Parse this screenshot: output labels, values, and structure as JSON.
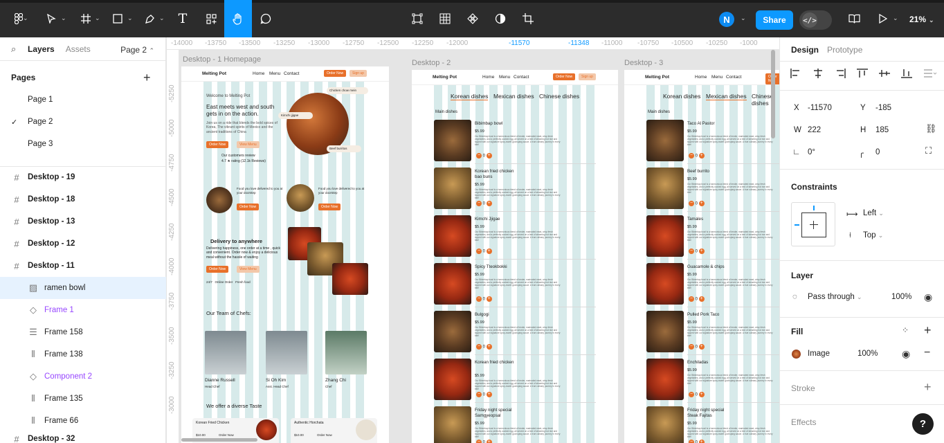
{
  "toolbar": {
    "zoom": "21%",
    "share": "Share",
    "avatar": "N",
    "tools": [
      "main-menu",
      "move-tool",
      "frame-tool",
      "shape-tool",
      "pen-tool",
      "text-tool",
      "resources",
      "hand-tool",
      "comment-tool"
    ],
    "center_tools": [
      "edit-object",
      "auto-layout-grid",
      "component",
      "mask",
      "crop"
    ]
  },
  "left": {
    "layers_tab": "Layers",
    "assets_tab": "Assets",
    "page_selector": "Page 2",
    "pages_heading": "Pages",
    "pages": [
      "Page 1",
      "Page 2",
      "Page 3"
    ],
    "layers": [
      {
        "name": "Desktop - 19",
        "icon": "frame-icon"
      },
      {
        "name": "Desktop - 18",
        "icon": "frame-icon"
      },
      {
        "name": "Desktop - 13",
        "icon": "frame-icon"
      },
      {
        "name": "Desktop - 12",
        "icon": "frame-icon"
      },
      {
        "name": "Desktop - 11",
        "icon": "frame-icon"
      }
    ],
    "children": [
      {
        "name": "ramen bowl",
        "icon": "image-icon"
      },
      {
        "name": "Frame 1",
        "icon": "component-instance-icon"
      },
      {
        "name": "Frame 158",
        "icon": "vertical-layout-icon"
      },
      {
        "name": "Frame 138",
        "icon": "horizontal-layout-icon"
      },
      {
        "name": "Component 2",
        "icon": "component-instance-icon"
      },
      {
        "name": "Frame 135",
        "icon": "horizontal-layout-icon"
      },
      {
        "name": "Frame 66",
        "icon": "horizontal-layout-icon"
      }
    ],
    "partial": "Desktop - 32"
  },
  "ruler": {
    "h": [
      "-14000",
      "-13750",
      "-13500",
      "-13250",
      "-13000",
      "-12750",
      "-12500",
      "-12250",
      "-12000",
      "-11570",
      "-11348",
      "-11000",
      "-10750",
      "-10500",
      "-10250",
      "-1000"
    ],
    "v": [
      "-5250",
      "-5000",
      "-4750",
      "-4500",
      "-4250",
      "-4000",
      "-3750",
      "-3500",
      "-3250",
      "-3000"
    ]
  },
  "canvas": {
    "frame1_label": "Desktop - 1 Homepage",
    "frame2_label": "Desktop - 2",
    "frame3_label": "Desktop - 3",
    "nav": {
      "brand": "Melting Pot",
      "links": [
        "Home",
        "Menu",
        "Contact"
      ],
      "order": "Order Now",
      "signup": "Sign up"
    },
    "home": {
      "welcome": "Welcome to Melting Pot",
      "headline": "East meets west and south gets in on the action.",
      "sub": "Join us on a ride that blends the bold spices of Korea, The vibrant spirits of Mexico and the ancient traditions of China",
      "order": "Order Now",
      "view": "View Menu",
      "reviews": "Our customers review",
      "rating": "4.7",
      "rating_note": "rating (12.1k Reviews)",
      "delivery": "Delivery to anywhere",
      "delivery_sub": "Delivering happiness, one order at a time , quick and convenient. Order now & enjoy a delicious meal without the hassle of waiting",
      "chefs_title": "Our Team of Chefs:",
      "chefs": [
        {
          "name": "Dianne Russell",
          "role": "Head Chef"
        },
        {
          "name": "Si Oh Kim",
          "role": "Asst. Head Chef"
        },
        {
          "name": "Zhang Chi",
          "role": "Chef"
        }
      ],
      "taste": "We offer a diverse Taste",
      "card1": "Korean Fried Chicken",
      "card2": "Authentic Horchata",
      "price1": "$10.00",
      "price2": "$10.00",
      "order_small": "Order Now",
      "bubbles": [
        "Chicken chow mein",
        "Kimchi jjigae",
        "Beef burritos"
      ],
      "love": "Food you love delivered to you at your doorstep",
      "badges": [
        "24/7",
        "Online Order",
        "Fresh food"
      ]
    },
    "menu2": {
      "tabs": [
        "Korean dishes",
        "Mexican dishes",
        "Chinese dishes"
      ],
      "section": "Main dishes",
      "items": [
        {
          "name": "Bibimbap bowl",
          "price": "$5.99"
        },
        {
          "name": "Korean fried chicken bao buns",
          "price": "$5.99"
        },
        {
          "name": "Kimchi Jjigae",
          "price": "$5.99"
        },
        {
          "name": "Spicy Tteokbokki",
          "price": "$5.99"
        },
        {
          "name": "Bulgogi",
          "price": "$5.99"
        },
        {
          "name": "Korean fried chicken",
          "price": "$5.99"
        },
        {
          "name": "Friday night special Samgyeopsal",
          "price": "$5.99"
        }
      ]
    },
    "menu3": {
      "tabs": [
        "Korean dishes",
        "Mexican dishes",
        "Chinese dishes"
      ],
      "section": "Main dishes",
      "items": [
        {
          "name": "Taco Al Pastor",
          "price": "$5.99"
        },
        {
          "name": "Beef burrito",
          "price": "$5.99"
        },
        {
          "name": "Tamales",
          "price": "$5.99"
        },
        {
          "name": "Guacamole & chips",
          "price": "$5.99"
        },
        {
          "name": "Pulled Pork Taco",
          "price": "$5.99"
        },
        {
          "name": "Enchiladas",
          "price": "$5.99"
        },
        {
          "name": "Friday night special Steak Fajitas",
          "price": "$5.99"
        }
      ]
    },
    "desc": "Our Bibimbap bowl is a harmonious blend of tender, marinated meat, crisp fresh vegetables, and a perfectly cooked egg, all served on a bed of steaming hot rice and topped with our signature spicy-sweet gochujang sauce. A true culinary journey in every bite!",
    "qty": "0"
  },
  "right": {
    "design_tab": "Design",
    "prototype_tab": "Prototype",
    "x_label": "X",
    "x": "-11570",
    "y_label": "Y",
    "y": "-185",
    "w_label": "W",
    "w": "222",
    "h_label": "H",
    "h": "185",
    "rotation": "0°",
    "radius": "0",
    "constraints": "Constraints",
    "h_constraint": "Left",
    "v_constraint": "Top",
    "layer": "Layer",
    "blend": "Pass through",
    "opacity": "100%",
    "fill": "Fill",
    "fill_type": "Image",
    "fill_opacity": "100%",
    "stroke": "Stroke",
    "effects": "Effects",
    "help": "?"
  }
}
